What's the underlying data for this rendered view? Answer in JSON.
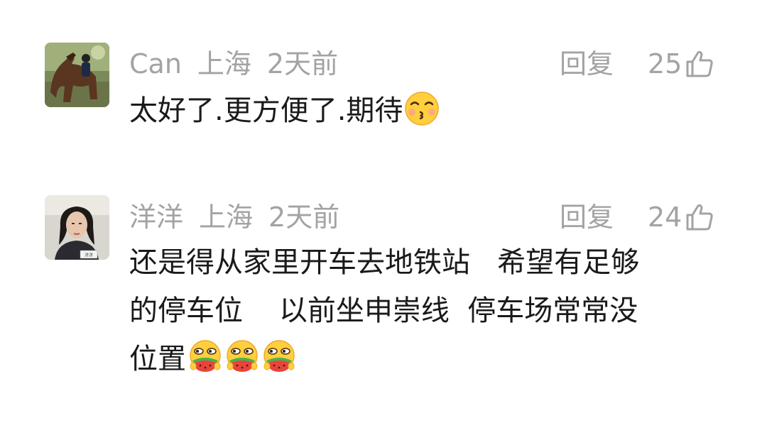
{
  "comments": [
    {
      "username": "Can",
      "location": "上海",
      "time": "2天前",
      "reply_label": "回复",
      "likes": "25",
      "text": "太好了.更方便了.期待",
      "emojis": [
        "kissing-smiling-eyes-emoji"
      ],
      "avatar": "horse-rider-photo"
    },
    {
      "username": "洋洋",
      "location": "上海",
      "time": "2天前",
      "reply_label": "回复",
      "likes": "24",
      "text": "还是得从家里开车去地铁站   希望有足够\n的停车位    以前坐申崇线  停车场常常没\n位置",
      "emojis": [
        "eating-watermelon-emoji",
        "eating-watermelon-emoji",
        "eating-watermelon-emoji"
      ],
      "avatar": "woman-portrait-photo",
      "avatar_tag": "洋洋"
    }
  ],
  "colors": {
    "meta_text": "#a3a3a3",
    "body_text": "#1a1a1a",
    "background": "#ffffff"
  },
  "icons": {
    "like": "thumbs-up-outline-icon"
  }
}
